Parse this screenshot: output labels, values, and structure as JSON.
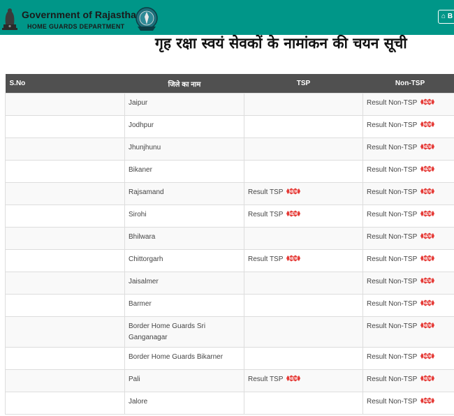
{
  "header": {
    "brand_title": "Government of Rajasthan",
    "brand_subtitle": "HOME GUARDS DEPARTMENT",
    "back_button_label": "B",
    "back_icon": "home-icon",
    "bg_color": "#009688"
  },
  "page_title": "गृह रक्षा स्वयं सेवकों के नामांकन की चयन सूची",
  "table": {
    "headers": {
      "sno": "S.No",
      "district": "जिले का नाम",
      "tsp": "TSP",
      "nontsp": "Non-TSP"
    },
    "new_badge_text": "NEW",
    "new_badge_color": "#e53935",
    "rows": [
      {
        "sno": "",
        "district": "Jaipur",
        "tsp": "",
        "nontsp": "Result Non-TSP"
      },
      {
        "sno": "",
        "district": "Jodhpur",
        "tsp": "",
        "nontsp": "Result Non-TSP"
      },
      {
        "sno": "",
        "district": "Jhunjhunu",
        "tsp": "",
        "nontsp": "Result Non-TSP"
      },
      {
        "sno": "",
        "district": "Bikaner",
        "tsp": "",
        "nontsp": "Result Non-TSP"
      },
      {
        "sno": "",
        "district": "Rajsamand",
        "tsp": "Result TSP",
        "nontsp": "Result Non-TSP"
      },
      {
        "sno": "",
        "district": "Sirohi",
        "tsp": "Result TSP",
        "nontsp": "Result Non-TSP"
      },
      {
        "sno": "",
        "district": "Bhilwara",
        "tsp": "",
        "nontsp": "Result Non-TSP"
      },
      {
        "sno": "",
        "district": "Chittorgarh",
        "tsp": "Result TSP",
        "nontsp": "Result Non-TSP"
      },
      {
        "sno": "",
        "district": "Jaisalmer",
        "tsp": "",
        "nontsp": "Result Non-TSP"
      },
      {
        "sno": "",
        "district": "Barmer",
        "tsp": "",
        "nontsp": "Result Non-TSP"
      },
      {
        "sno": "",
        "district": "Border Home Guards Sri Ganganagar",
        "tsp": "",
        "nontsp": "Result Non-TSP"
      },
      {
        "sno": "",
        "district": "Border Home Guards Bikarner",
        "tsp": "",
        "nontsp": "Result Non-TSP"
      },
      {
        "sno": "",
        "district": "Pali",
        "tsp": "Result TSP",
        "nontsp": "Result Non-TSP"
      },
      {
        "sno": "",
        "district": "Jalore",
        "tsp": "",
        "nontsp": "Result Non-TSP"
      }
    ]
  }
}
